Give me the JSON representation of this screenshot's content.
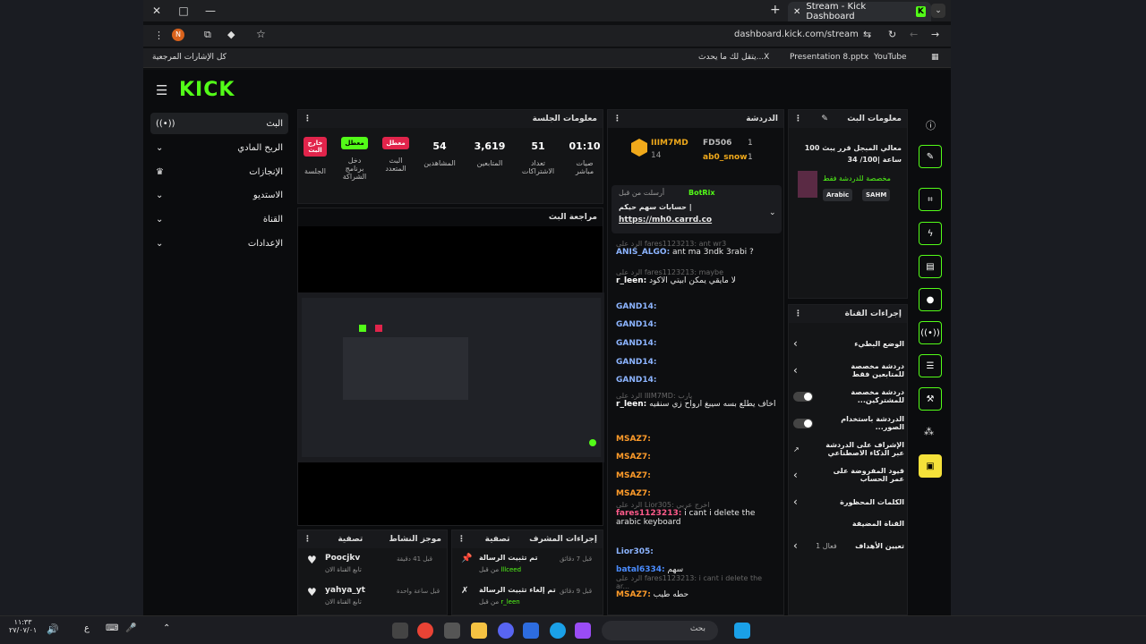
{
  "browser": {
    "tab_title": "Stream - Kick Dashboard",
    "url": "dashboard.kick.com/stream",
    "bookmarks": [
      "كل الإشارات المرجعية",
      "يتقل لك ما يحدث...X",
      "Presentation 8.pptx",
      "YouTube"
    ]
  },
  "logo": "KICK",
  "sidebar": {
    "items": [
      {
        "label": "البث"
      },
      {
        "label": "الربح المادي"
      },
      {
        "label": "الإنجازات"
      },
      {
        "label": "الاستديو"
      },
      {
        "label": "القناة"
      },
      {
        "label": "الإعدادات"
      }
    ]
  },
  "session": {
    "title": "معلومات الجلسة",
    "stats": [
      {
        "value": "",
        "label": "الجلسة",
        "badge": "خارج البث",
        "badge_color": "#e1244b"
      },
      {
        "value": "",
        "label": "دخل برنامج الشراكة",
        "badge": "معطل",
        "badge_color": "#53fc18"
      },
      {
        "value": "",
        "label": "البث المتعدد",
        "badge": "معطل",
        "badge_color": "#e1244b"
      },
      {
        "value": "54",
        "label": "المشاهدين"
      },
      {
        "value": "3,619",
        "label": "المتابعين"
      },
      {
        "value": "51",
        "label": "تعداد الاشتراكات"
      },
      {
        "value": "01:10",
        "label": "صيات مباشر"
      }
    ]
  },
  "preview": {
    "title": "مراجعة البث"
  },
  "activity": {
    "title": "موجز النشاط",
    "filter": "تصفية",
    "items": [
      {
        "user": "Poocjkv",
        "text": "تابع القناة الان",
        "time": "قبل 41 دقيقة"
      },
      {
        "user": "yahya_yt",
        "text": "تابع القناة الان",
        "time": "قبل ساعة واحدة"
      }
    ]
  },
  "mod_actions": {
    "title": "إجراءات المشرف",
    "filter": "تصفية",
    "items": [
      {
        "action": "تم تثبيت الرسالة",
        "by": "من قبل",
        "user": "lllceed",
        "time": "قبل 7 دقائق"
      },
      {
        "action": "تم إلغاء تثبيت الرسالة",
        "by": "من قبل",
        "user": "r_leen",
        "time": "قبل 9 دقائق"
      }
    ]
  },
  "chat": {
    "title": "الدردشة",
    "top_gifters": [
      {
        "name": "IIIM7MD",
        "count": "14"
      },
      {
        "name": "FD506",
        "count": "1"
      },
      {
        "name": "ab0_snow",
        "count": "1"
      }
    ],
    "pinned": {
      "by": "أرسلت من قبل",
      "user": "BotRix",
      "text": "حسابات سهم حيكم |",
      "link": "https://mh0.carrd.co"
    },
    "messages": [
      {
        "reply": "الرد على fares1123213: ant wr3",
        "user": "ANIS_ALGO",
        "user_color": "#8cb4ff",
        "text": "ant ma 3ndk 3rabi ?"
      },
      {
        "reply": "الرد على fares1123213: maybe",
        "user": "r_leen",
        "user_color": "#ffffff",
        "text": "لا مايقي يمكن ابيتي الاكود"
      },
      {
        "reply": "",
        "user": "GAND14",
        "user_color": "#8cb4ff",
        "text": ""
      },
      {
        "reply": "",
        "user": "GAND14",
        "user_color": "#8cb4ff",
        "text": ""
      },
      {
        "reply": "",
        "user": "GAND14",
        "user_color": "#8cb4ff",
        "text": ""
      },
      {
        "reply": "",
        "user": "GAND14",
        "user_color": "#8cb4ff",
        "text": ""
      },
      {
        "reply": "",
        "user": "GAND14",
        "user_color": "#8cb4ff",
        "text": ""
      },
      {
        "reply": "الرد على IIIM7MD: يارب",
        "user": "r_leen",
        "user_color": "#ffffff",
        "text": "اخاف يطلع بسه سيبغ ارواح زي سنقيه"
      },
      {
        "reply": "",
        "user": "MSAZ7",
        "user_color": "#ff9c2a",
        "text": ""
      },
      {
        "reply": "",
        "user": "MSAZ7",
        "user_color": "#ff9c2a",
        "text": ""
      },
      {
        "reply": "",
        "user": "MSAZ7",
        "user_color": "#ff9c2a",
        "text": ""
      },
      {
        "reply": "",
        "user": "MSAZ7",
        "user_color": "#ff9c2a",
        "text": ""
      },
      {
        "reply": "الرد على Lior305: اخرج عربي",
        "user": "fares1123213",
        "user_color": "#ff5b8b",
        "text": "i cant i delete the arabic keyboard"
      },
      {
        "reply": "",
        "user": "Lior305",
        "user_color": "#8cb4ff",
        "text": ""
      },
      {
        "reply": "",
        "user": "batal6334",
        "user_color": "#4a8cff",
        "text": "سهم"
      },
      {
        "reply": "الرد على fares1123213: i cant i delete the ar...",
        "user": "MSAZ7",
        "user_color": "#ff9c2a",
        "text": "حطه طيب"
      }
    ]
  },
  "stream_info": {
    "title": "معلومات البث",
    "stream_title": "معالي المبجل قرر يبث 100 ساعة |100/ 34",
    "category": "مخصصة للدردشة فقط",
    "tags": [
      "Arabic",
      "SAHM"
    ]
  },
  "channel_actions": {
    "title": "إجراءات القناة",
    "items": [
      {
        "label": "الوضع البطيء",
        "control": "chevron"
      },
      {
        "label": "دردشة مخصصة للمتابعين فقط",
        "control": "chevron"
      },
      {
        "label": "دردشة مخصصة للمشتركين...",
        "control": "toggle"
      },
      {
        "label": "الدردشة باستخدام الصور...",
        "control": "toggle"
      },
      {
        "label": "الإشراف على الدردشة عبر الذكاء الاصطناعي",
        "control": "icon"
      },
      {
        "label": "قيود المفروضة على عمر الحساب",
        "control": "chevron"
      },
      {
        "label": "الكلمات المحظورة",
        "control": "chevron"
      },
      {
        "label": "القناة المضيفة",
        "control": "none"
      },
      {
        "label": "تعيين الأهداف",
        "control": "chevron",
        "extra": "فعال 1"
      }
    ]
  },
  "taskbar": {
    "search": "بحث",
    "clock_time": "١١:٣٣",
    "clock_date": "٢٧/٠٧/٠١",
    "lang": "ع"
  }
}
